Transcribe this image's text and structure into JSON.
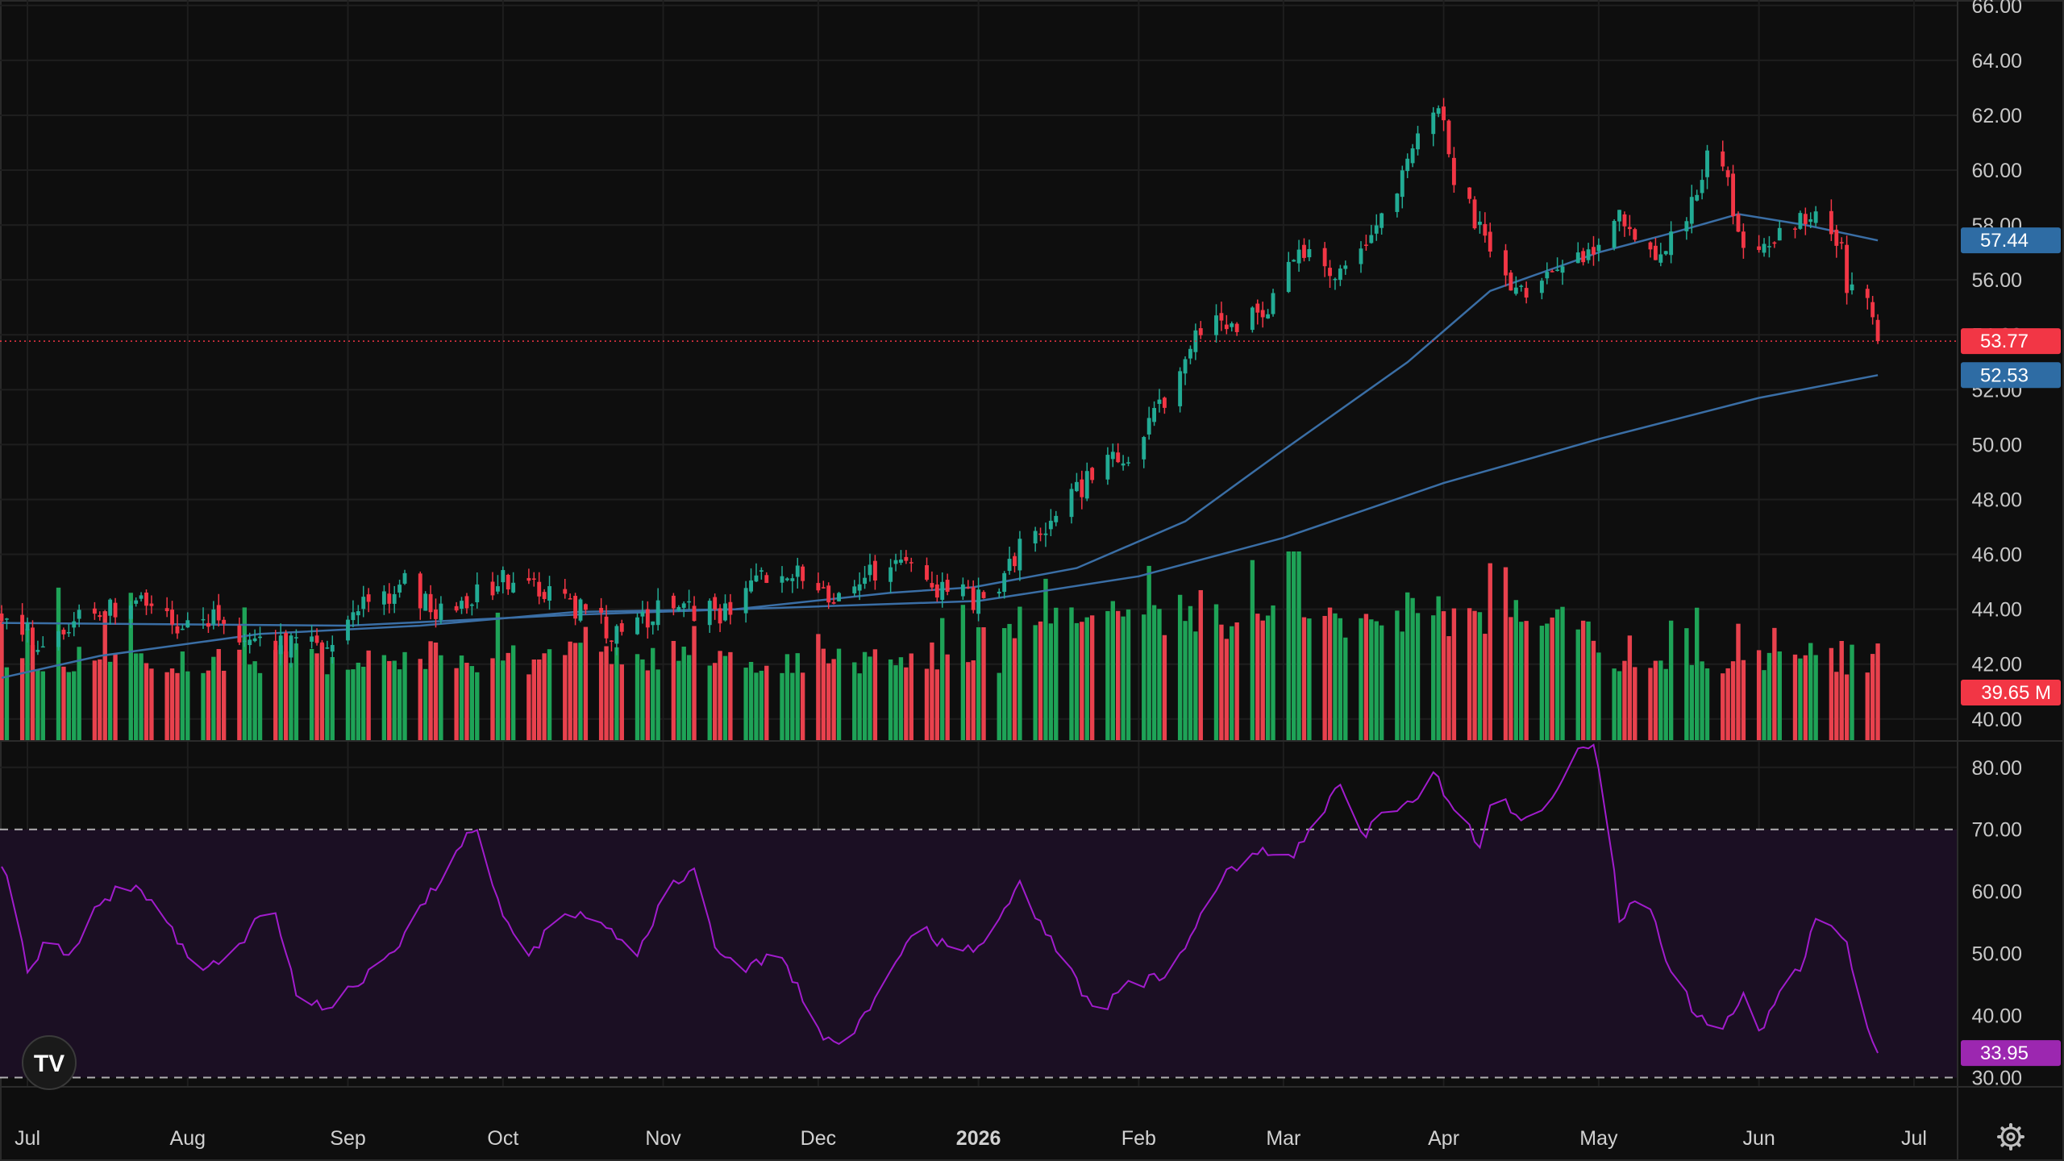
{
  "chart_data": [
    {
      "type": "candlestick",
      "x_months": [
        "Jul",
        "Aug",
        "Sep",
        "Oct",
        "Nov",
        "Dec",
        "2026",
        "Feb",
        "Mar",
        "Apr",
        "May",
        "Jun",
        "Jul"
      ],
      "x_range": [
        "2025-06-26",
        "2026-07-06"
      ],
      "ylim": [
        39.2,
        66.2
      ],
      "y_ticks": [
        "40.00",
        "42.00",
        "44.00",
        "46.00",
        "48.00",
        "50.00",
        "52.00",
        "54.00",
        "56.00",
        "58.00",
        "60.00",
        "62.00",
        "64.00",
        "66.00"
      ],
      "grid": true,
      "price_keypoints": [
        [
          "2025-06-26",
          43.7
        ],
        [
          "2025-07-03",
          42.8
        ],
        [
          "2025-07-15",
          44.0
        ],
        [
          "2025-07-22",
          44.3
        ],
        [
          "2025-08-01",
          43.2
        ],
        [
          "2025-08-07",
          43.9
        ],
        [
          "2025-08-14",
          42.7
        ],
        [
          "2025-08-26",
          42.6
        ],
        [
          "2025-09-05",
          44.3
        ],
        [
          "2025-09-12",
          44.9
        ],
        [
          "2025-09-19",
          43.8
        ],
        [
          "2025-10-03",
          45.2
        ],
        [
          "2025-10-10",
          44.6
        ],
        [
          "2025-10-17",
          43.8
        ],
        [
          "2025-10-24",
          43.0
        ],
        [
          "2025-10-31",
          43.9
        ],
        [
          "2025-11-07",
          44.0
        ],
        [
          "2025-11-14",
          43.8
        ],
        [
          "2025-11-21",
          45.3
        ],
        [
          "2025-11-28",
          45.2
        ],
        [
          "2025-12-05",
          44.2
        ],
        [
          "2025-12-12",
          45.4
        ],
        [
          "2025-12-19",
          45.7
        ],
        [
          "2025-12-24",
          44.6
        ],
        [
          "2025-12-31",
          44.4
        ],
        [
          "2026-01-06",
          45.0
        ],
        [
          "2026-01-09",
          46.2
        ],
        [
          "2026-01-16",
          47.3
        ],
        [
          "2026-01-23",
          48.9
        ],
        [
          "2026-01-30",
          49.6
        ],
        [
          "2026-02-06",
          51.6
        ],
        [
          "2026-02-12",
          54.1
        ],
        [
          "2026-02-19",
          54.4
        ],
        [
          "2026-02-26",
          55.0
        ],
        [
          "2026-03-04",
          57.2
        ],
        [
          "2026-03-11",
          56.0
        ],
        [
          "2026-03-18",
          57.4
        ],
        [
          "2026-03-25",
          60.3
        ],
        [
          "2026-03-31",
          62.7
        ],
        [
          "2026-04-03",
          59.6
        ],
        [
          "2026-04-09",
          57.5
        ],
        [
          "2026-04-14",
          55.3
        ],
        [
          "2026-04-21",
          56.4
        ],
        [
          "2026-04-28",
          56.6
        ],
        [
          "2026-05-05",
          58.6
        ],
        [
          "2026-05-12",
          56.7
        ],
        [
          "2026-05-19",
          58.6
        ],
        [
          "2026-05-22",
          60.7
        ],
        [
          "2026-05-26",
          59.4
        ],
        [
          "2026-05-29",
          57.1
        ],
        [
          "2026-06-05",
          57.7
        ],
        [
          "2026-06-12",
          58.7
        ],
        [
          "2026-06-17",
          56.9
        ],
        [
          "2026-06-18",
          55.6
        ],
        [
          "2026-06-22",
          55.1
        ],
        [
          "2026-06-24",
          53.77
        ]
      ],
      "ma_50": [
        [
          "2025-06-26",
          41.5
        ],
        [
          "2025-07-15",
          42.3
        ],
        [
          "2025-08-15",
          43.1
        ],
        [
          "2025-09-15",
          43.4
        ],
        [
          "2025-10-15",
          43.9
        ],
        [
          "2025-11-15",
          44.0
        ],
        [
          "2025-12-15",
          44.6
        ],
        [
          "2025-12-31",
          44.8
        ],
        [
          "2026-01-20",
          45.5
        ],
        [
          "2026-02-10",
          47.2
        ],
        [
          "2026-03-01",
          49.8
        ],
        [
          "2026-03-25",
          53.0
        ],
        [
          "2026-04-10",
          55.6
        ],
        [
          "2026-05-01",
          57.0
        ],
        [
          "2026-05-15",
          57.7
        ],
        [
          "2026-05-28",
          58.4
        ],
        [
          "2026-06-10",
          58.0
        ],
        [
          "2026-06-24",
          57.44
        ]
      ],
      "ma_200": [
        [
          "2025-06-26",
          43.5
        ],
        [
          "2025-09-01",
          43.4
        ],
        [
          "2025-10-15",
          43.8
        ],
        [
          "2025-12-01",
          44.1
        ],
        [
          "2026-01-01",
          44.3
        ],
        [
          "2026-02-01",
          45.2
        ],
        [
          "2026-03-01",
          46.6
        ],
        [
          "2026-04-01",
          48.6
        ],
        [
          "2026-05-01",
          50.2
        ],
        [
          "2026-06-01",
          51.7
        ],
        [
          "2026-06-24",
          52.53
        ]
      ],
      "last_price": "53.77",
      "ma_50_value": "57.44",
      "ma_200_value": "52.53",
      "volume": "39.65 M",
      "colors": {
        "up": "#22ab94",
        "down": "#f23645",
        "volume_up": "#1ea357",
        "volume_down": "#e8414d",
        "ma": "#3a6ea5",
        "badge_blue": "#2e6ca4",
        "badge_red": "#f23645",
        "price_line": "#f23645"
      }
    },
    {
      "type": "line",
      "series_id": "rsi",
      "ylim": [
        28.5,
        84
      ],
      "y_ticks": [
        "30.00",
        "40.00",
        "50.00",
        "60.00",
        "70.00",
        "80.00"
      ],
      "band": [
        30,
        70
      ],
      "rsi_keypoints": [
        [
          "2025-06-26",
          65
        ],
        [
          "2025-07-01",
          48
        ],
        [
          "2025-07-05",
          52
        ],
        [
          "2025-07-10",
          50
        ],
        [
          "2025-07-15",
          58
        ],
        [
          "2025-07-20",
          62
        ],
        [
          "2025-07-28",
          55
        ],
        [
          "2025-08-03",
          47
        ],
        [
          "2025-08-10",
          50
        ],
        [
          "2025-08-17",
          59
        ],
        [
          "2025-08-22",
          44
        ],
        [
          "2025-08-28",
          41
        ],
        [
          "2025-09-05",
          47
        ],
        [
          "2025-09-12",
          53
        ],
        [
          "2025-09-20",
          64
        ],
        [
          "2025-09-26",
          71
        ],
        [
          "2025-09-30",
          58
        ],
        [
          "2025-10-06",
          50
        ],
        [
          "2025-10-13",
          57
        ],
        [
          "2025-10-20",
          55
        ],
        [
          "2025-10-27",
          50
        ],
        [
          "2025-11-02",
          60
        ],
        [
          "2025-11-07",
          64
        ],
        [
          "2025-11-11",
          52
        ],
        [
          "2025-11-16",
          46
        ],
        [
          "2025-11-23",
          51
        ],
        [
          "2025-11-28",
          43
        ],
        [
          "2025-12-02",
          35
        ],
        [
          "2025-12-07",
          37
        ],
        [
          "2025-12-13",
          44
        ],
        [
          "2025-12-20",
          55
        ],
        [
          "2025-12-27",
          50
        ],
        [
          "2026-01-03",
          52
        ],
        [
          "2026-01-09",
          61
        ],
        [
          "2026-01-12",
          56
        ],
        [
          "2026-01-18",
          48
        ],
        [
          "2026-01-24",
          40
        ],
        [
          "2026-01-30",
          45
        ],
        [
          "2026-02-05",
          46
        ],
        [
          "2026-02-11",
          53
        ],
        [
          "2026-02-18",
          63
        ],
        [
          "2026-02-25",
          67
        ],
        [
          "2026-03-03",
          66
        ],
        [
          "2026-03-09",
          73
        ],
        [
          "2026-03-12",
          77
        ],
        [
          "2026-03-16",
          69
        ],
        [
          "2026-03-21",
          73
        ],
        [
          "2026-03-26",
          75
        ],
        [
          "2026-03-30",
          79
        ],
        [
          "2026-04-04",
          72
        ],
        [
          "2026-04-08",
          68
        ],
        [
          "2026-04-11",
          77
        ],
        [
          "2026-04-16",
          71
        ],
        [
          "2026-04-22",
          75
        ],
        [
          "2026-04-26",
          82
        ],
        [
          "2026-04-30",
          83
        ],
        [
          "2026-05-03",
          70
        ],
        [
          "2026-05-05",
          55
        ],
        [
          "2026-05-10",
          60
        ],
        [
          "2026-05-15",
          47
        ],
        [
          "2026-05-20",
          40
        ],
        [
          "2026-05-25",
          38
        ],
        [
          "2026-05-29",
          43
        ],
        [
          "2026-06-01",
          37
        ],
        [
          "2026-06-05",
          44
        ],
        [
          "2026-06-10",
          49
        ],
        [
          "2026-06-13",
          59
        ],
        [
          "2026-06-16",
          53
        ],
        [
          "2026-06-18",
          52
        ],
        [
          "2026-06-20",
          43
        ],
        [
          "2026-06-22",
          37
        ],
        [
          "2026-06-24",
          33.95
        ]
      ],
      "rsi_value": "33.95",
      "colors": {
        "line": "#a11ccc",
        "band_fill": "#1b0f23",
        "band_line": "#d8d8d8",
        "badge": "#9c27b0"
      }
    }
  ],
  "toolbar": {
    "logo_icon": "tradingview-logo-icon",
    "settings_icon": "gear-icon"
  }
}
